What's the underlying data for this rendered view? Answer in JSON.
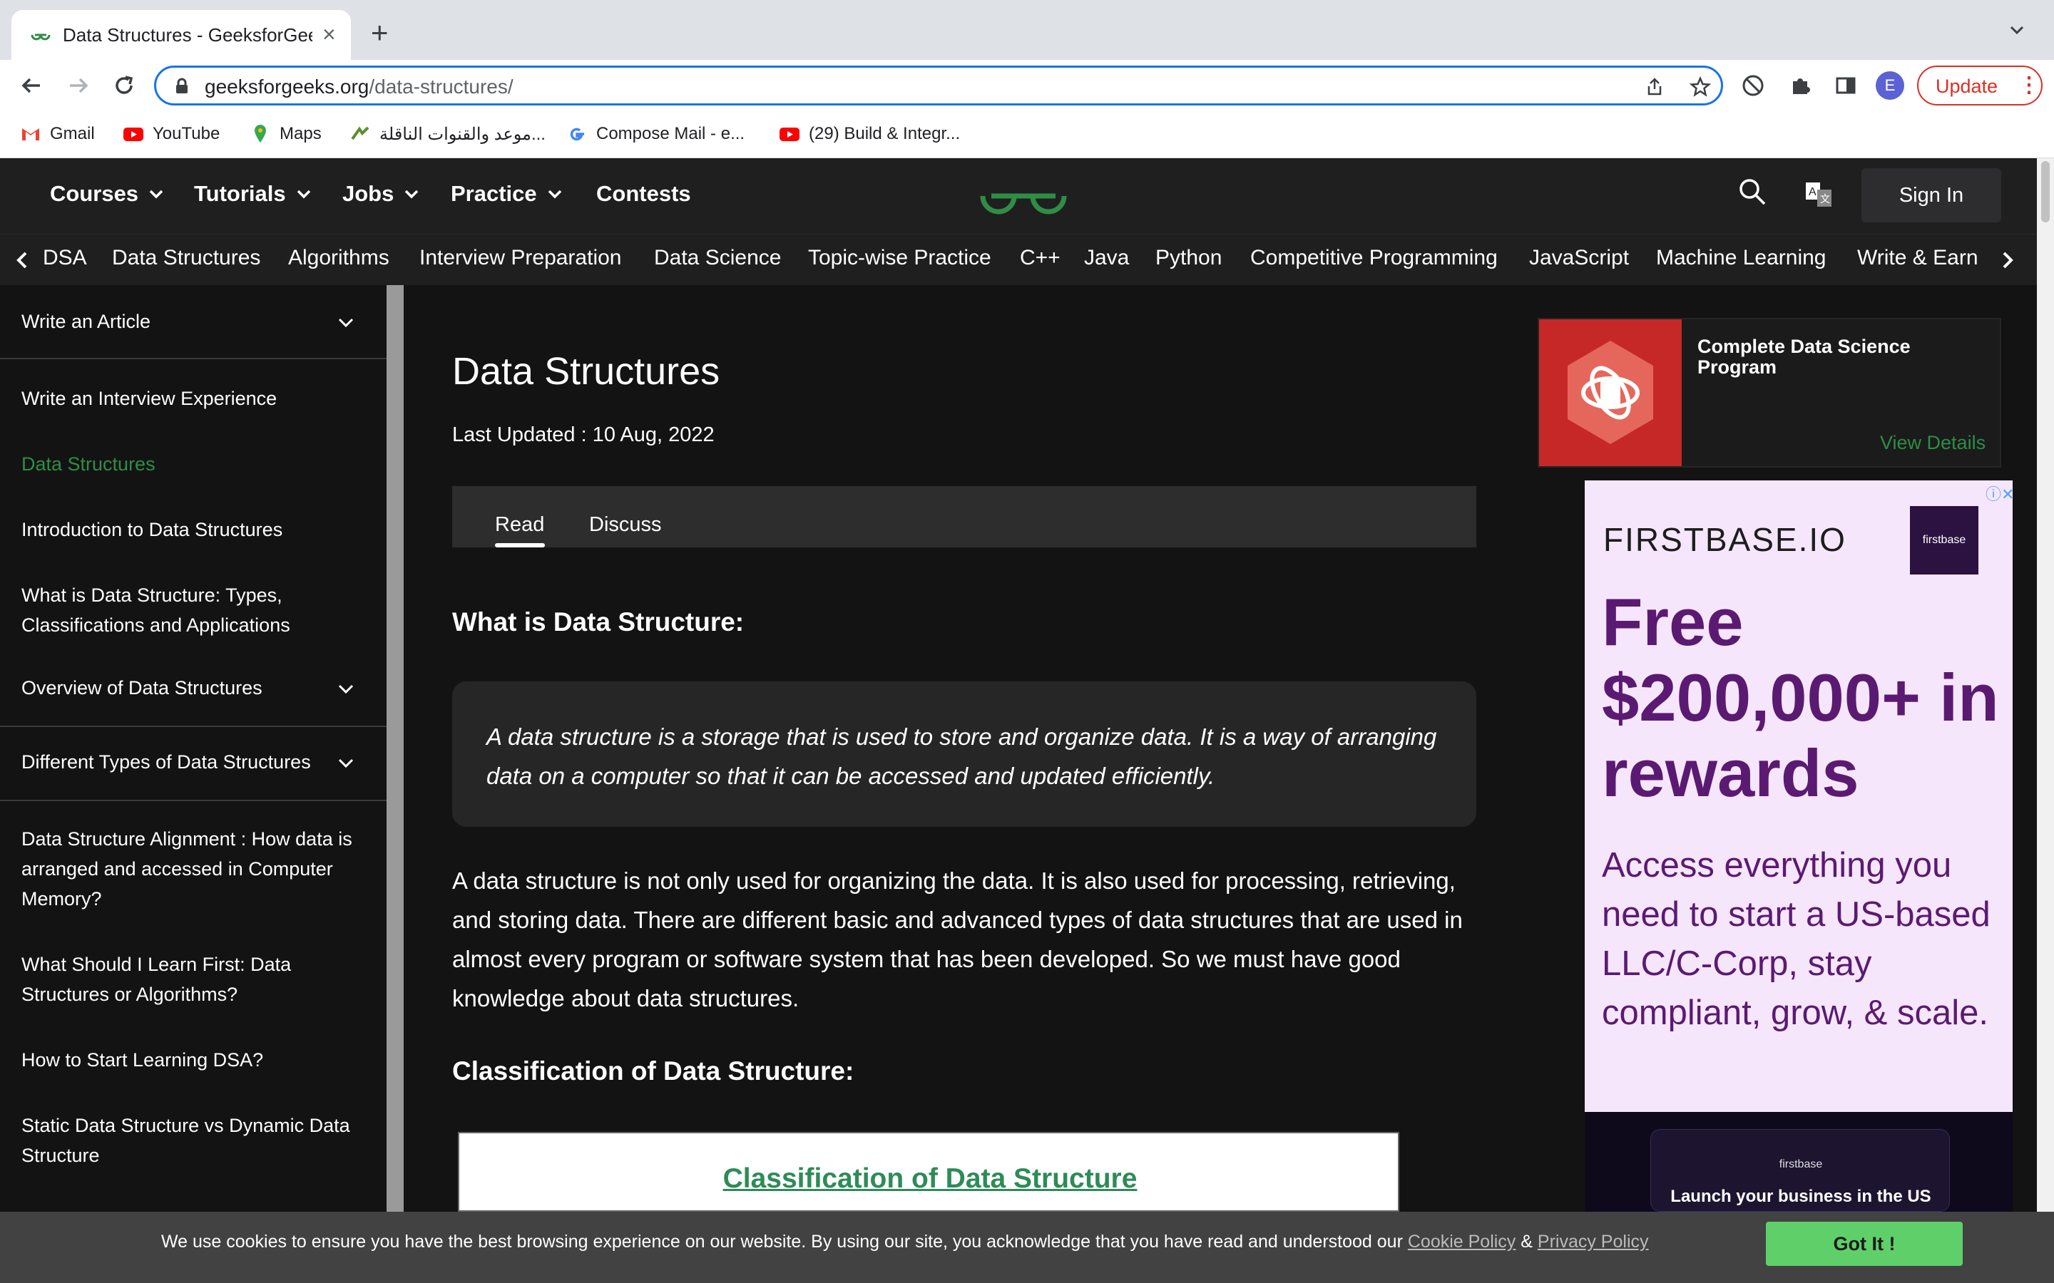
{
  "browser": {
    "tab_title": "Data Structures - GeeksforGeeks",
    "url_host": "geeksforgeeks.org",
    "url_path": "/data-structures/",
    "update_label": "Update",
    "profile_initial": "E",
    "bookmarks": [
      {
        "label": "Gmail",
        "icon": "gmail-icon"
      },
      {
        "label": "YouTube",
        "icon": "youtube-icon"
      },
      {
        "label": "Maps",
        "icon": "maps-icon"
      },
      {
        "label": "موعد والقنوات الناقلة...",
        "icon": "sports-icon"
      },
      {
        "label": "Compose Mail - e...",
        "icon": "google-icon"
      },
      {
        "label": "(29) Build & Integr...",
        "icon": "youtube-icon"
      }
    ]
  },
  "gfg_nav": {
    "items": [
      "Courses",
      "Tutorials",
      "Jobs",
      "Practice",
      "Contests"
    ],
    "signin": "Sign In",
    "sub_items": [
      "DSA",
      "Data Structures",
      "Algorithms",
      "Interview Preparation",
      "Data Science",
      "Topic-wise Practice",
      "C++",
      "Java",
      "Python",
      "Competitive Programming",
      "JavaScript",
      "Machine Learning",
      "Write & Earn"
    ]
  },
  "sidebar": {
    "items": [
      "Write an Article",
      "Write an Interview Experience",
      "Data Structures",
      "Introduction to Data Structures",
      "What is Data Structure: Types, Classifications and Applications",
      "Overview of Data Structures",
      "Different Types of Data Structures",
      "Data Structure Alignment : How data is arranged and accessed in Computer Memory?",
      "What Should I Learn First: Data Structures or Algorithms?",
      "How to Start Learning DSA?",
      "Static Data Structure vs Dynamic Data Structure"
    ],
    "active_color": "#2f8d46"
  },
  "article": {
    "title": "Data Structures",
    "last_updated": "Last Updated : 10 Aug, 2022",
    "tabs": [
      "Read",
      "Discuss"
    ],
    "h2_what": "What is Data Structure:",
    "quote": "A data structure is a storage that is used to store and organize data. It is a way of arranging data on a computer so that it can be accessed and updated efficiently.",
    "para": "A data structure is not only used for organizing the data. It is also used for processing, retrieving, and storing data. There are different basic and advanced types of data structures that are used in almost every program or software system that has been developed. So we must have good knowledge about data structures.",
    "h2_class": "Classification of Data Structure:",
    "figure_caption": "Classification of Data Structure"
  },
  "promo": {
    "title": "Complete Data Science Program",
    "link": "View Details"
  },
  "ad": {
    "brand": "FIRSTBASE.IO",
    "logo_text": "firstbase",
    "headline": "Free $200,000+ in rewards",
    "body": "Access everything you need to start a US-based LLC/C-Corp, stay compliant, grow, & scale.",
    "ad2_logo": "firstbase",
    "ad2_text": "Launch your business in the US"
  },
  "cookie": {
    "text": "We use cookies to ensure you have the best browsing experience on our website. By using our site, you acknowledge that you have read and understood our",
    "cookie_policy": "Cookie Policy",
    "amp": "&",
    "privacy_policy": "Privacy Policy",
    "button": "Got It !"
  }
}
